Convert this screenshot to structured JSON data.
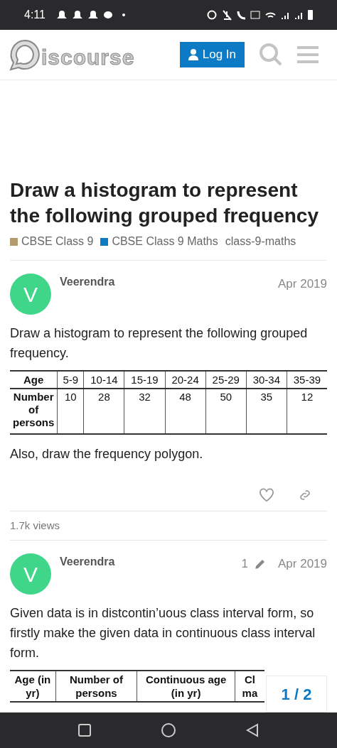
{
  "status_bar": {
    "time": "4:11"
  },
  "header": {
    "logo_text": "iscourse",
    "login_label": "Log In"
  },
  "topic": {
    "title": "Draw a histogram to represent the following grouped frequency",
    "categories": [
      {
        "label": "CBSE Class 9",
        "color": "#b49b6b"
      },
      {
        "label": "CBSE Class 9 Maths",
        "color": "#0e7ac4"
      }
    ],
    "tags": [
      "class-9-maths"
    ]
  },
  "posts": [
    {
      "avatar_letter": "V",
      "author": "Veerendra",
      "date": "Apr 2019",
      "body_before": "Draw a histogram to represent the following grouped frequency.",
      "table": {
        "columns": [
          "Age",
          "5-9",
          "10-14",
          "15-19",
          "20-24",
          "25-29",
          "30-34",
          "35-39"
        ],
        "rows": [
          [
            "Number of persons",
            "10",
            "28",
            "32",
            "48",
            "50",
            "35",
            "12"
          ]
        ]
      },
      "body_after": "Also, draw the frequency polygon.",
      "liked": false,
      "views": "1.7k views"
    },
    {
      "avatar_letter": "V",
      "author": "Veerendra",
      "edits": "1",
      "date": "Apr 2019",
      "body_before": "Given data is in distcontin’uous class interval form, so firstly make the given data in continuous class interval form.",
      "table": {
        "columns": [
          "Age (in yr)",
          "Number of persons",
          "Continuous age (in yr)",
          "Cl ma"
        ]
      }
    }
  ],
  "progress": {
    "label": "1 / 2"
  }
}
